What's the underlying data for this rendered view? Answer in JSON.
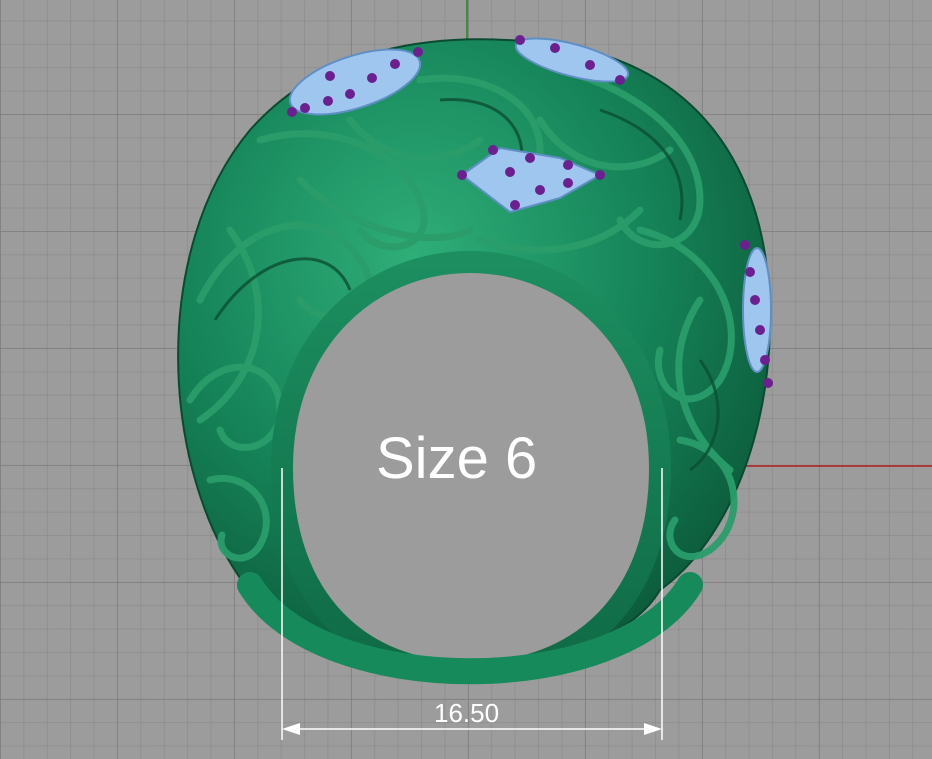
{
  "viewport": {
    "size_label": "Size 6",
    "dimension_value": "16.50",
    "colors": {
      "background": "#9c9c9c",
      "ring": "#127a50",
      "ring_highlight": "#2fae78",
      "gem": "#9fc6ef",
      "prong": "#6c1f8f",
      "axis_x": "#b02020",
      "axis_y": "#1f8a1f",
      "annotation": "#ffffff"
    }
  }
}
